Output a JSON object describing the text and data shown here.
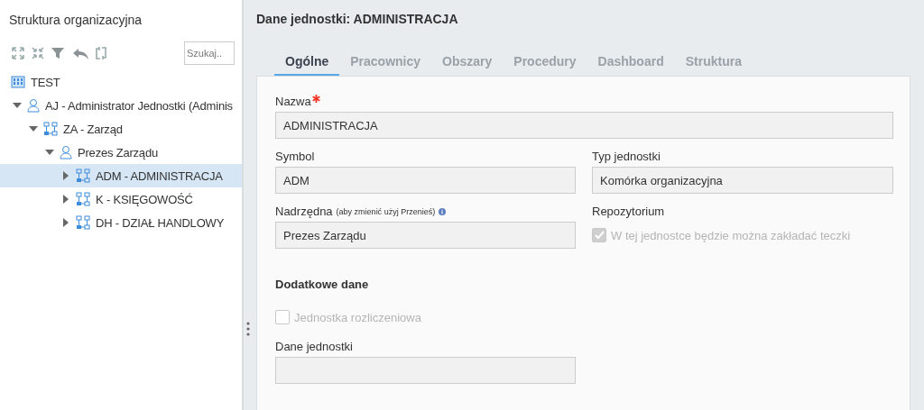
{
  "sidebar": {
    "title": "Struktura organizacyjna",
    "search": {
      "placeholder": "Szukaj.."
    },
    "tree": [
      {
        "kind": "root",
        "label": "TEST"
      },
      {
        "kind": "person",
        "label": "AJ - Administrator Jednostki (Adminis",
        "expanded": true,
        "selected": false,
        "children": [
          {
            "kind": "unit",
            "label": "ZA - Zarząd",
            "expanded": true,
            "selected": false,
            "children": [
              {
                "kind": "person",
                "label": "Prezes Zarządu",
                "expanded": true,
                "selected": false,
                "children": [
                  {
                    "kind": "unit",
                    "label": "ADM - ADMINISTRACJA",
                    "expanded": false,
                    "selected": true
                  },
                  {
                    "kind": "unit",
                    "label": "K - KSIĘGOWOŚĆ",
                    "expanded": false,
                    "selected": false
                  },
                  {
                    "kind": "unit",
                    "label": "DH - DZIAŁ HANDLOWY",
                    "expanded": false,
                    "selected": false
                  }
                ]
              }
            ]
          }
        ]
      }
    ]
  },
  "detail": {
    "title": "Dane jednostki: ADMINISTRACJA",
    "tabs": [
      {
        "label": "Ogólne",
        "selected": true
      },
      {
        "label": "Pracownicy",
        "selected": false
      },
      {
        "label": "Obszary",
        "selected": false
      },
      {
        "label": "Procedury",
        "selected": false
      },
      {
        "label": "Dashboard",
        "selected": false
      },
      {
        "label": "Struktura",
        "selected": false
      }
    ],
    "name": {
      "label": "Nazwa",
      "required": true,
      "value": "ADMINISTRACJA"
    },
    "symbol": {
      "label": "Symbol",
      "value": "ADM"
    },
    "unit_type": {
      "label": "Typ jednostki",
      "value": "Komórka organizacyjna"
    },
    "parent": {
      "label": "Nadrzędna",
      "hint": "(aby zmienić użyj Przenieś)",
      "value": "Prezes Zarządu"
    },
    "repository": {
      "label": "Repozytorium",
      "checkbox": {
        "label": "W tej jednostce będzie można zakładać teczki",
        "checked": true,
        "disabled": true
      }
    },
    "extra": {
      "title": "Dodatkowe dane",
      "checkbox": {
        "label": "Jednostka rozliczeniowa",
        "checked": false,
        "disabled": true
      },
      "data": {
        "label": "Dane jednostki"
      }
    }
  }
}
